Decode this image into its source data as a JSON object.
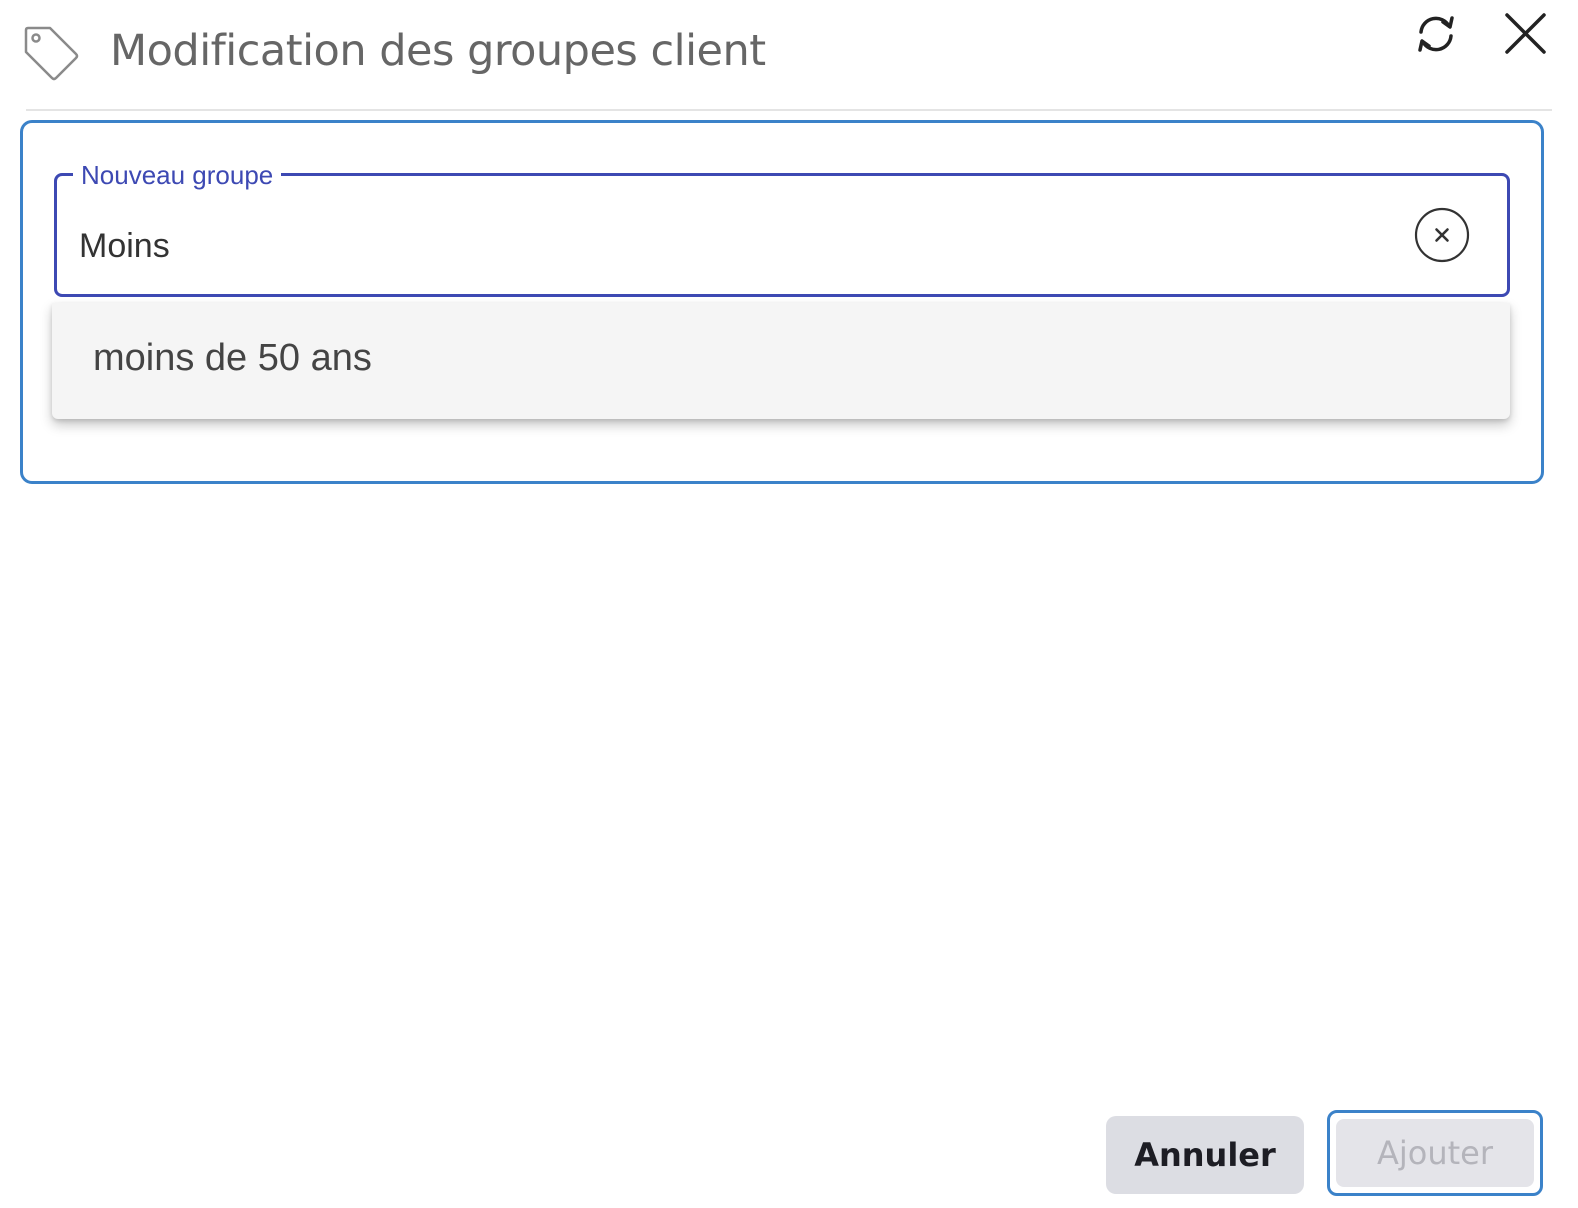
{
  "dialog": {
    "title": "Modification des groupes client",
    "icons": {
      "title_icon": "tag-icon",
      "refresh": "refresh-icon",
      "close": "close-icon"
    }
  },
  "form": {
    "field_label": "Nouveau groupe",
    "field_value": "Moins",
    "clear_icon": "clear-circle-x-icon",
    "suggestions": [
      "moins de 50 ans"
    ]
  },
  "footer": {
    "cancel_label": "Annuler",
    "add_label": "Ajouter",
    "add_disabled": true
  },
  "colors": {
    "accent": "#3d49b3",
    "focus_outline": "#3b82c9",
    "title_text": "#666666",
    "dropdown_bg": "#f5f5f5",
    "cancel_bg": "#dcdde3",
    "add_disabled_bg": "#e4e4e9"
  }
}
